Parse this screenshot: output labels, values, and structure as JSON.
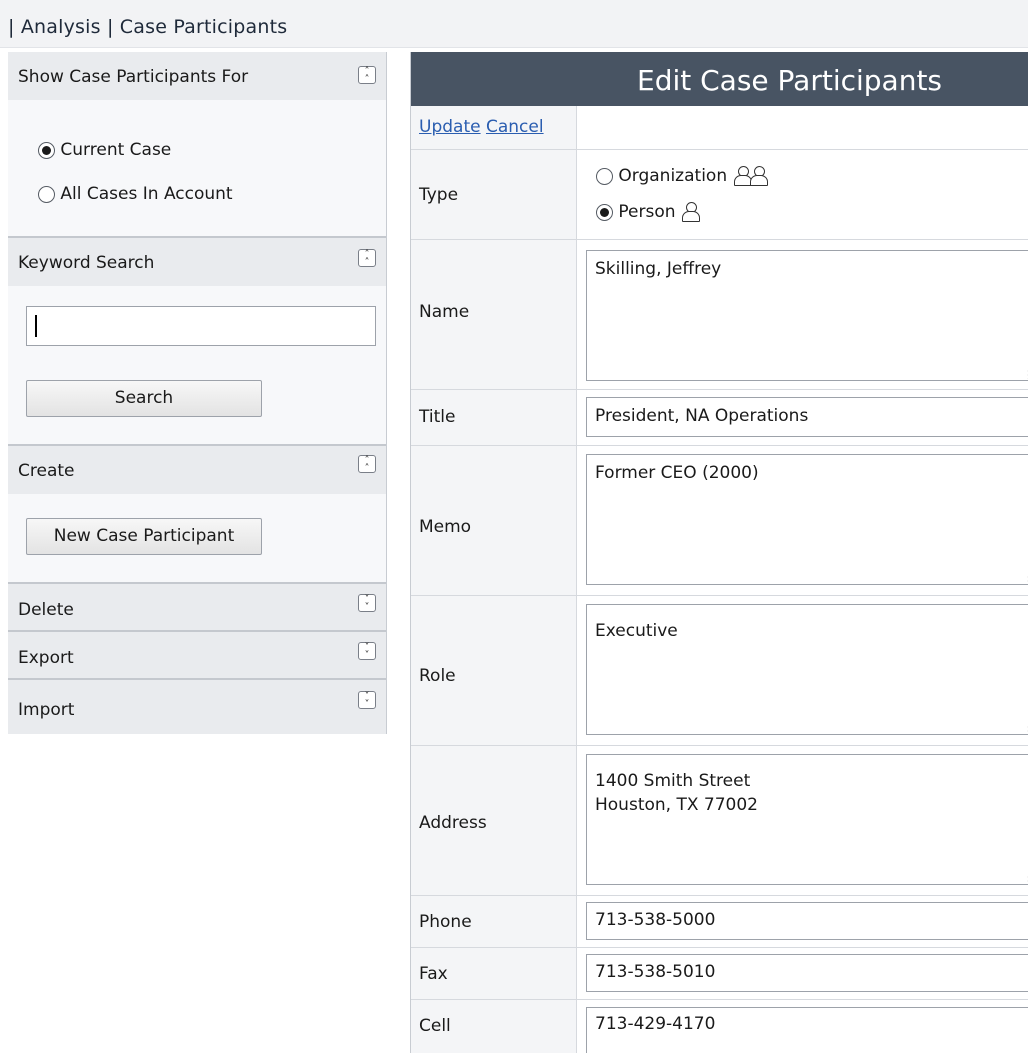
{
  "breadcrumb": "| Analysis | Case Participants",
  "left": {
    "show_for": {
      "title": "Show Case Participants For",
      "options": [
        {
          "label": "Current Case",
          "checked": true
        },
        {
          "label": "All Cases In Account",
          "checked": false
        }
      ]
    },
    "keyword": {
      "title": "Keyword Search",
      "value": "",
      "button": "Search"
    },
    "create": {
      "title": "Create",
      "button": "New Case Participant"
    },
    "delete": {
      "title": "Delete"
    },
    "export": {
      "title": "Export"
    },
    "import": {
      "title": "Import"
    }
  },
  "edit": {
    "title": "Edit Case Participants",
    "update": "Update",
    "cancel": "Cancel",
    "labels": {
      "type": "Type",
      "name": "Name",
      "title": "Title",
      "memo": "Memo",
      "role": "Role",
      "address": "Address",
      "phone": "Phone",
      "fax": "Fax",
      "cell": "Cell"
    },
    "type_options": [
      {
        "label": "Organization",
        "checked": false,
        "icon": "group-icon"
      },
      {
        "label": "Person",
        "checked": true,
        "icon": "person-icon"
      }
    ],
    "values": {
      "name": "Skilling, Jeffrey",
      "title": "President, NA Operations",
      "memo": "Former CEO (2000)",
      "role": "Executive",
      "address": "1400 Smith Street\nHouston, TX 77002",
      "phone": "713-538-5000",
      "fax": "713-538-5010",
      "cell": "713-429-4170"
    }
  },
  "colors": {
    "header_bar": "#485463",
    "link": "#2a5db0",
    "section_head": "#e9ebee"
  }
}
